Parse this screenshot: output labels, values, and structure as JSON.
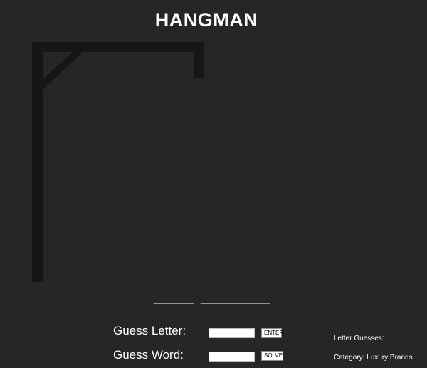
{
  "title": "HANGMAN",
  "puzzle": {
    "word_display": "____  _______",
    "category_label": "Category:",
    "category_value": "Luxury Brands"
  },
  "controls": {
    "guess_letter_label": "Guess Letter:",
    "guess_letter_value": "",
    "enter_button": "ENTER",
    "guess_word_label": "Guess Word:",
    "guess_word_value": "",
    "solve_button": "SOLVE"
  },
  "letter_guesses": {
    "label": "Letter Guesses:",
    "letters": ""
  },
  "colors": {
    "background": "#252627",
    "gallows": "#161616",
    "text": "#ffffff"
  },
  "hangman": {
    "wrong_guesses": 0,
    "body_parts_shown": []
  }
}
